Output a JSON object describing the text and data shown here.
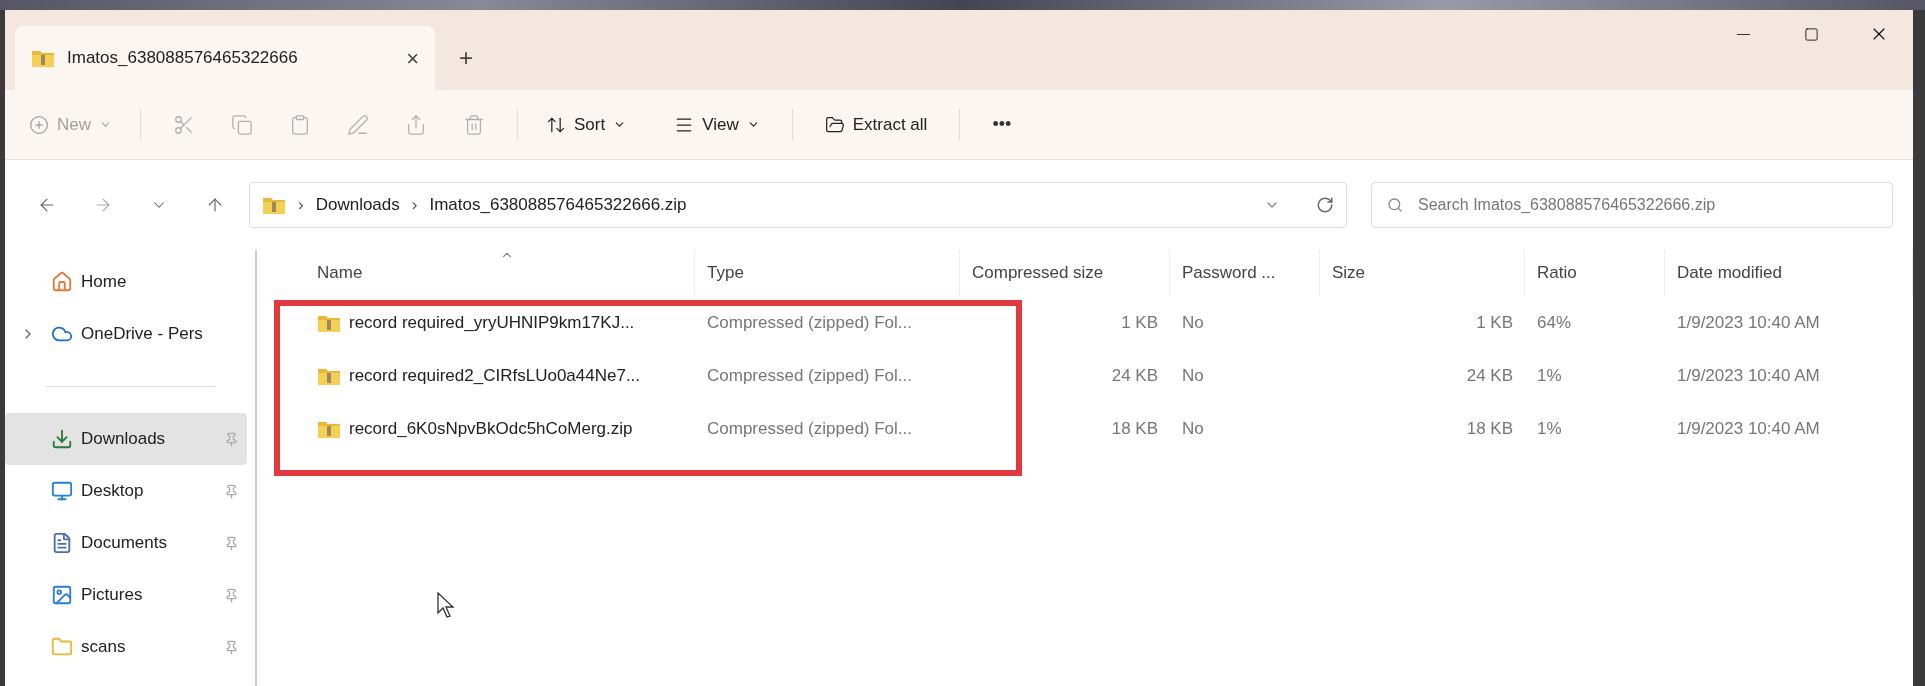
{
  "tab": {
    "title": "Imatos_638088576465322666",
    "close": "×",
    "new_tab": "+",
    "selected": true
  },
  "toolbar": {
    "new": {
      "label": "New",
      "disabled": true
    },
    "sort": {
      "label": "Sort"
    },
    "view": {
      "label": "View"
    },
    "extract": {
      "label": "Extract all"
    },
    "more": "•••"
  },
  "address": {
    "crumbs": [
      "Downloads",
      "Imatos_638088576465322666.zip"
    ],
    "separator": "›"
  },
  "search": {
    "placeholder": "Search Imatos_638088576465322666.zip"
  },
  "sidebar": {
    "items": [
      {
        "label": "Home",
        "kind": "place",
        "selected": false,
        "pinned": false
      },
      {
        "label": "OneDrive - Pers",
        "kind": "group",
        "selected": false,
        "pinned": false
      },
      {
        "label": "Downloads",
        "kind": "place",
        "selected": true,
        "pinned": true
      },
      {
        "label": "Desktop",
        "kind": "place",
        "selected": false,
        "pinned": true
      },
      {
        "label": "Documents",
        "kind": "place",
        "selected": false,
        "pinned": true
      },
      {
        "label": "Pictures",
        "kind": "place",
        "selected": false,
        "pinned": true
      },
      {
        "label": "scans",
        "kind": "place",
        "selected": false,
        "pinned": true
      }
    ]
  },
  "table": {
    "columns": [
      {
        "label": "Name",
        "sorted": true
      },
      {
        "label": "Type",
        "sorted": false
      },
      {
        "label": "Compressed size",
        "sorted": false
      },
      {
        "label": "Password ...",
        "sorted": false
      },
      {
        "label": "Size",
        "sorted": false
      },
      {
        "label": "Ratio",
        "sorted": false
      },
      {
        "label": "Date modified",
        "sorted": false
      }
    ],
    "rows": [
      {
        "cells": [
          "record required_yryUHNIP9km17KJ...",
          "Compressed (zipped) Fol...",
          "1 KB",
          "No",
          "1 KB",
          "64%",
          "1/9/2023 10:40 AM"
        ]
      },
      {
        "cells": [
          "record required2_CIRfsLUo0a44Ne7...",
          "Compressed (zipped) Fol...",
          "24 KB",
          "No",
          "24 KB",
          "1%",
          "1/9/2023 10:40 AM"
        ]
      },
      {
        "cells": [
          "record_6K0sNpvBkOdc5hCoMerg.zip",
          "Compressed (zipped) Fol...",
          "18 KB",
          "No",
          "18 KB",
          "1%",
          "1/9/2023 10:40 AM"
        ]
      }
    ]
  }
}
